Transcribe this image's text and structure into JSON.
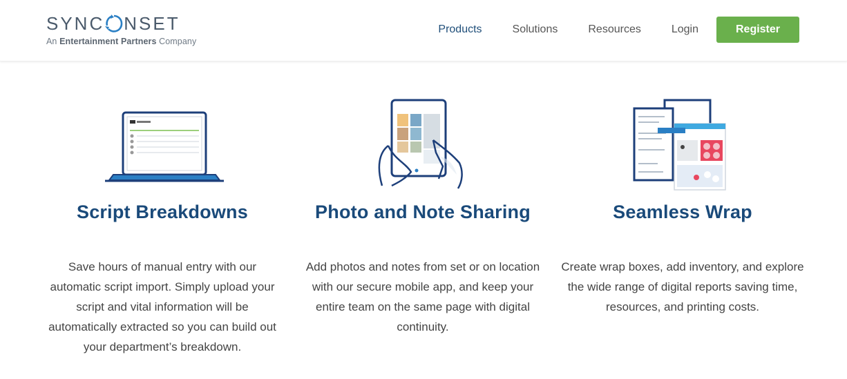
{
  "header": {
    "logo": {
      "wordmark": "SYNCONSET",
      "tagline_prefix": "An",
      "tagline_bold": "Entertainment Partners",
      "tagline_suffix": "Company"
    },
    "nav": {
      "products": "Products",
      "solutions": "Solutions",
      "resources": "Resources",
      "login": "Login",
      "register": "Register"
    },
    "colors": {
      "accent_green": "#6ab04c",
      "brand_blue": "#1a4a7a"
    }
  },
  "features": [
    {
      "icon": "laptop-icon",
      "title": "Script Breakdowns",
      "description": "Save hours of manual entry with our automatic script import. Simply upload your script and vital information will be automatically extracted so you can build out your department’s breakdown."
    },
    {
      "icon": "tablet-hands-icon",
      "title": "Photo and Note Sharing",
      "description": "Add photos and notes from set or on location with our secure mobile app, and keep your entire team on the same page with digital continuity."
    },
    {
      "icon": "reports-documents-icon",
      "title": "Seamless Wrap",
      "description": "Create wrap boxes, add inventory, and explore the wide range of digital reports saving time, resources, and printing costs."
    }
  ]
}
